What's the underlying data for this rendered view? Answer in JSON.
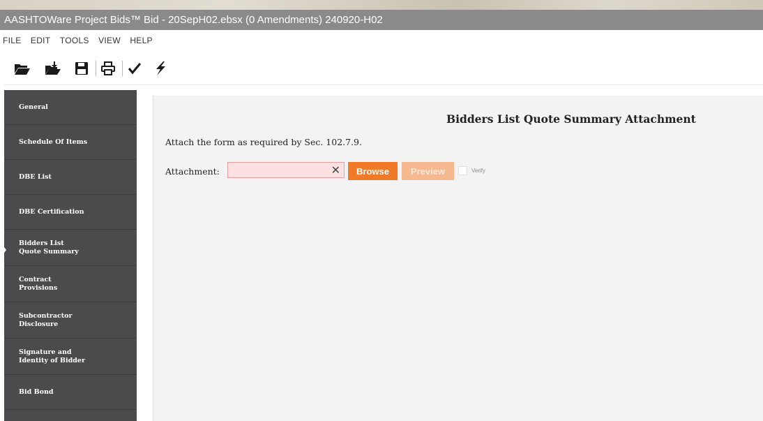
{
  "window": {
    "title": "AASHTOWare Project Bids™ Bid - 20SepH02.ebsx (0 Amendments) 240920-H02"
  },
  "menu": [
    "FILE",
    "EDIT",
    "TOOLS",
    "VIEW",
    "HELP"
  ],
  "toolbar": {
    "icons": [
      "open-folder-icon",
      "import-icon",
      "save-icon",
      "print-icon",
      "check-icon",
      "lightning-icon"
    ]
  },
  "sidebar": {
    "items": [
      {
        "label": "General"
      },
      {
        "label": "Schedule Of Items"
      },
      {
        "label": "DBE List"
      },
      {
        "label": "DBE Certification"
      },
      {
        "label": "Bidders List\nQuote Summary",
        "active": true
      },
      {
        "label": "Contract\nProvisions"
      },
      {
        "label": "Subcontractor\nDisclosure"
      },
      {
        "label": "Signature and\nIdentity of Bidder"
      },
      {
        "label": "Bid Bond"
      }
    ]
  },
  "main": {
    "title": "Bidders List Quote Summary Attachment",
    "instruction": "Attach the form as required by Sec. 102.7.9.",
    "attachment_label": "Attachment:",
    "attachment_value": "",
    "clear_symbol": "✕",
    "browse_label": "Browse",
    "preview_label": "Preview",
    "verify_label": "Verify",
    "verify_checked": false
  },
  "colors": {
    "sidebar_bg": "#4b4b4d",
    "accent_orange": "#f07a28",
    "disabled_orange": "#f6b88e",
    "invalid_input_bg": "#fbe1e1",
    "titlebar_bg": "#8a8a8a"
  }
}
